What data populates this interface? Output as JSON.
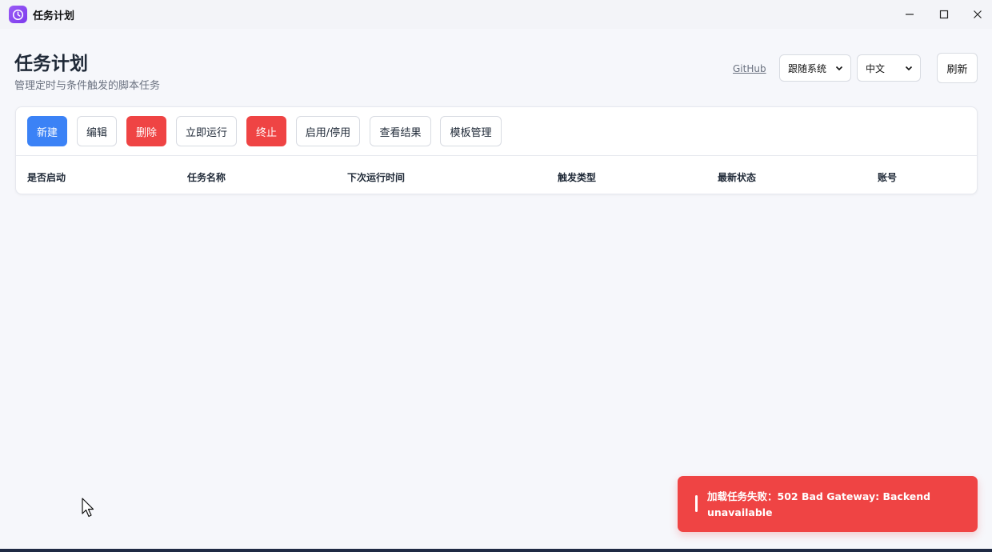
{
  "window": {
    "title": "任务计划",
    "icon": "clock-app-icon",
    "controls": [
      "minimize-icon",
      "maximize-icon",
      "close-icon"
    ]
  },
  "header": {
    "title": "任务计划",
    "subtitle": "管理定时与条件触发的脚本任务",
    "github_label": "GitHub",
    "theme_select": {
      "value": "跟随系统"
    },
    "lang_select": {
      "value": "中文"
    },
    "refresh_label": "刷新"
  },
  "toolbar": {
    "new_label": "新建",
    "edit_label": "编辑",
    "delete_label": "删除",
    "run_now_label": "立即运行",
    "stop_label": "终止",
    "toggle_label": "启用/停用",
    "view_results_label": "查看结果",
    "templates_label": "模板管理"
  },
  "table": {
    "columns": [
      "是否启动",
      "任务名称",
      "下次运行时间",
      "触发类型",
      "最新状态",
      "账号"
    ],
    "rows": []
  },
  "toast": {
    "message": "加载任务失败：502 Bad Gateway: Backend unavailable"
  },
  "colors": {
    "primary": "#3b82f6",
    "danger": "#ef4444",
    "app_icon": "#8b5cf6"
  }
}
